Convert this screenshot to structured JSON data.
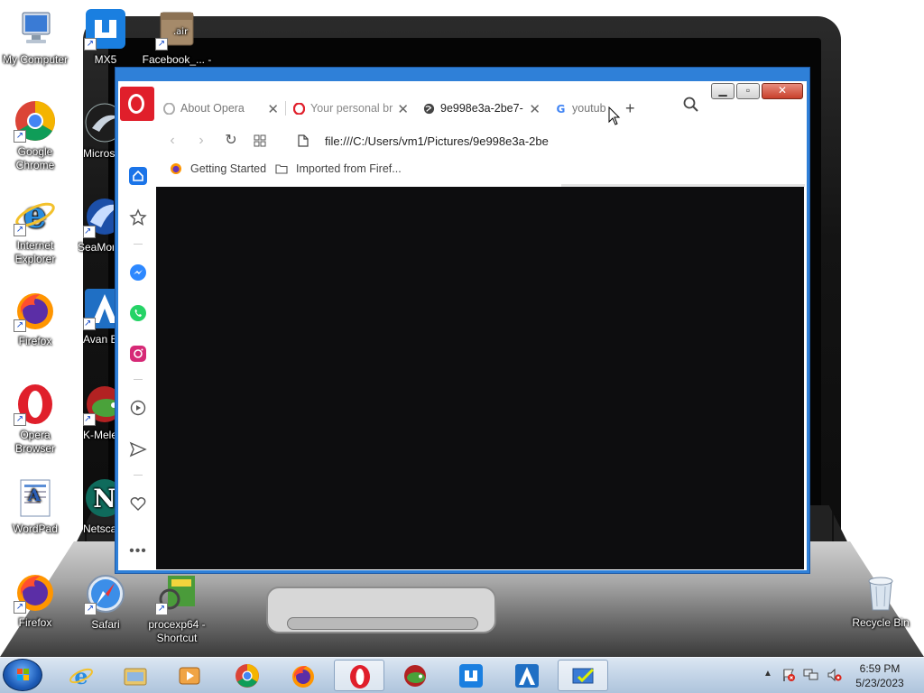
{
  "desktop": {
    "icons_left": [
      {
        "label": "My Computer"
      },
      {
        "label": "Google Chrome"
      },
      {
        "label": "Internet Explorer"
      },
      {
        "label": "Firefox"
      },
      {
        "label": "Opera Browser"
      },
      {
        "label": "WordPad"
      },
      {
        "label": "Firefox"
      }
    ],
    "icons_col2": [
      {
        "label": "MX5"
      },
      {
        "label": "Micros Silverlig"
      },
      {
        "label": "SeaMon"
      },
      {
        "label": "Avan Brows"
      },
      {
        "label": "K-Mele"
      },
      {
        "label": "Netsca Naviga"
      },
      {
        "label": "Safari"
      }
    ],
    "icons_col3": [
      {
        "label": "Facebook_... - Shortcut"
      },
      {
        "label": "procexp64 - Shortcut"
      }
    ],
    "recycle_bin": {
      "label": "Recycle Bin"
    }
  },
  "browser": {
    "tabs": [
      {
        "label": "About Opera",
        "icon": "opera-icon"
      },
      {
        "label": "Your personal br",
        "icon": "opera-icon"
      },
      {
        "label": "9e998e3a-2be7-",
        "icon": "globe-icon"
      },
      {
        "label": "youtub",
        "icon": "google-icon"
      }
    ],
    "new_tab_label": "+",
    "address": "file:///C:/Users/vm1/Pictures/9e998e3a-2be",
    "bookmarks": [
      {
        "label": "Getting Started",
        "icon": "firefox-icon"
      },
      {
        "label": "Imported from Firef...",
        "icon": "folder-icon"
      }
    ]
  },
  "taskbar": {
    "apps": [
      "internet-explorer-icon",
      "explorer-folder-icon",
      "media-player-icon",
      "chrome-icon",
      "firefox-icon",
      "opera-icon",
      "k-meleon-icon",
      "maxthon-icon",
      "avant-icon",
      "remote-app-icon"
    ],
    "clock_time": "6:59 PM",
    "clock_date": "5/23/2023"
  },
  "colors": {
    "opera_red": "#e01f2b",
    "taskbar": "#c3d4e7",
    "window_frame": "#2f80d8"
  }
}
